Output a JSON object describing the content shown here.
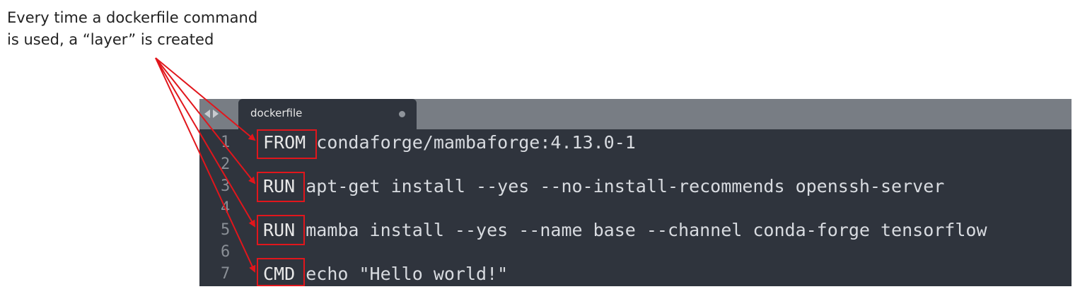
{
  "annotation": {
    "line1": "Every time a dockerfile command",
    "line2": "is used, a “layer” is created"
  },
  "editor": {
    "tab_label": "dockerfile",
    "lines": [
      {
        "number": "1",
        "keyword": "FROM",
        "rest": "condaforge/mambaforge:4.13.0-1"
      },
      {
        "number": "2",
        "keyword": "",
        "rest": ""
      },
      {
        "number": "3",
        "keyword": "RUN",
        "rest": "apt-get install --yes --no-install-recommends openssh-server"
      },
      {
        "number": "4",
        "keyword": "",
        "rest": ""
      },
      {
        "number": "5",
        "keyword": "RUN",
        "rest": "mamba install --yes --name base --channel conda-forge tensorflow"
      },
      {
        "number": "6",
        "keyword": "",
        "rest": ""
      },
      {
        "number": "7",
        "keyword": "CMD",
        "rest": "echo \"Hello world!\""
      }
    ]
  },
  "colors": {
    "highlight": "#e1161c",
    "editor_bg": "#2f343d",
    "tabbar_bg": "#787d84"
  },
  "icons": [
    "back-arrow-icon",
    "forward-arrow-icon",
    "unsaved-dot-icon"
  ]
}
